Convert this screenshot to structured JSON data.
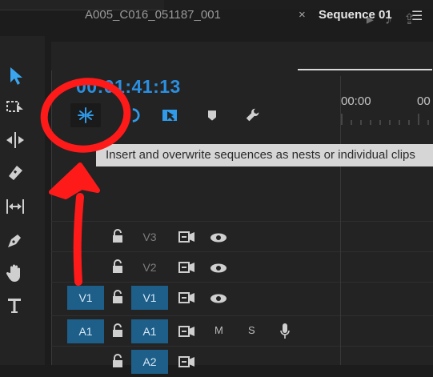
{
  "timeline": {
    "tabs": [
      {
        "label": "A005_C016_051187_001"
      },
      {
        "label": "Sequence 01"
      }
    ],
    "tab_close": "×",
    "panel_menu": "☰",
    "timecode": "00:01:41:13",
    "ruler": [
      "00:00",
      "00"
    ],
    "tooltip": "Insert and overwrite sequences as nests or individual clips"
  },
  "tracks": [
    {
      "id": "V3",
      "source": "",
      "target": "V3",
      "type": "video",
      "source_active": false,
      "target_active": false
    },
    {
      "id": "V2",
      "source": "",
      "target": "V2",
      "type": "video",
      "source_active": false,
      "target_active": false
    },
    {
      "id": "V1",
      "source": "V1",
      "target": "V1",
      "type": "video",
      "source_active": true,
      "target_active": true
    },
    {
      "id": "A1",
      "source": "A1",
      "target": "A1",
      "type": "audio",
      "source_active": true,
      "target_active": true,
      "mute": "M",
      "solo": "S"
    },
    {
      "id": "A2",
      "source": "",
      "target": "A2",
      "type": "audio",
      "source_active": false,
      "target_active": true
    }
  ],
  "colors": {
    "accent_blue": "#2b8fe0",
    "annotation_red": "#ff1a1a",
    "track_active": "#1e5f8a"
  }
}
